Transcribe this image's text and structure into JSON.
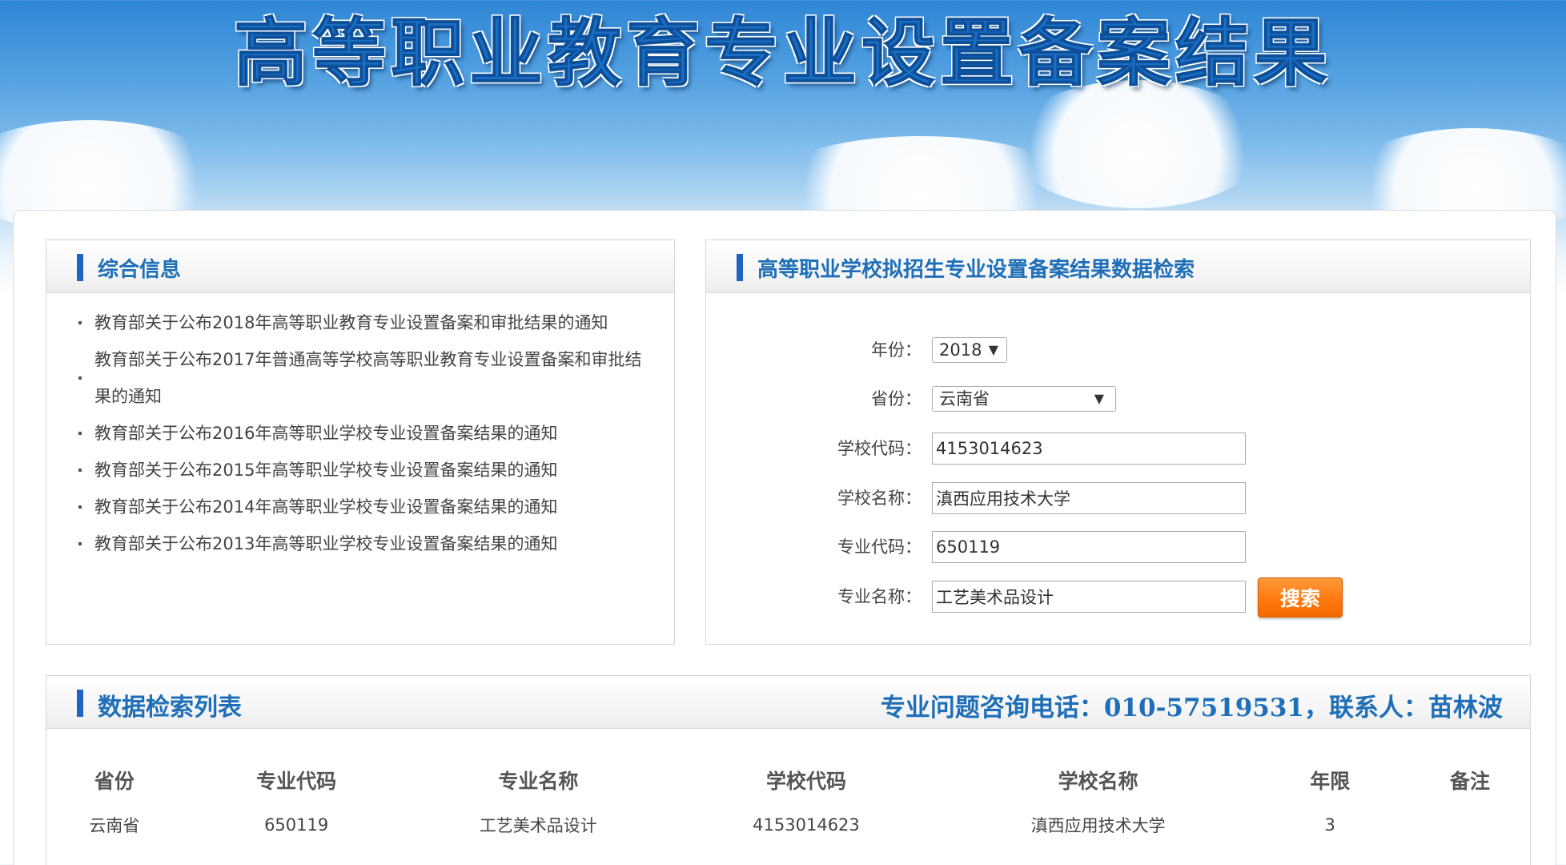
{
  "banner": {
    "title": "高等职业教育专业设置备案结果"
  },
  "info_panel": {
    "title": "综合信息",
    "items": [
      "教育部关于公布2018年高等职业教育专业设置备案和审批结果的通知",
      "教育部关于公布2017年普通高等学校高等职业教育专业设置备案和审批结果的通知",
      "教育部关于公布2016年高等职业学校专业设置备案结果的通知",
      "教育部关于公布2015年高等职业学校专业设置备案结果的通知",
      "教育部关于公布2014年高等职业学校专业设置备案结果的通知",
      "教育部关于公布2013年高等职业学校专业设置备案结果的通知"
    ]
  },
  "search_panel": {
    "title": "高等职业学校拟招生专业设置备案结果数据检索",
    "year_label": "年份：",
    "year_value": "2018",
    "province_label": "省份：",
    "province_value": "云南省",
    "school_code_label": "学校代码：",
    "school_code_value": "4153014623",
    "school_name_label": "学校名称：",
    "school_name_value": "滇西应用技术大学",
    "major_code_label": "专业代码：",
    "major_code_value": "650119",
    "major_name_label": "专业名称：",
    "major_name_value": "工艺美术品设计",
    "search_button": "搜索",
    "dropdown_arrow": "▼"
  },
  "results_panel": {
    "title": "数据检索列表",
    "contact": "专业问题咨询电话：010-57519531，联系人：苗林波",
    "columns": [
      "省份",
      "专业代码",
      "专业名称",
      "学校代码",
      "学校名称",
      "年限",
      "备注"
    ],
    "rows": [
      [
        "云南省",
        "650119",
        "工艺美术品设计",
        "4153014623",
        "滇西应用技术大学",
        "3",
        ""
      ]
    ]
  },
  "colors": {
    "accent": "#1f6fb8",
    "bar": "#1f63c7",
    "button": "#ff7a10"
  }
}
